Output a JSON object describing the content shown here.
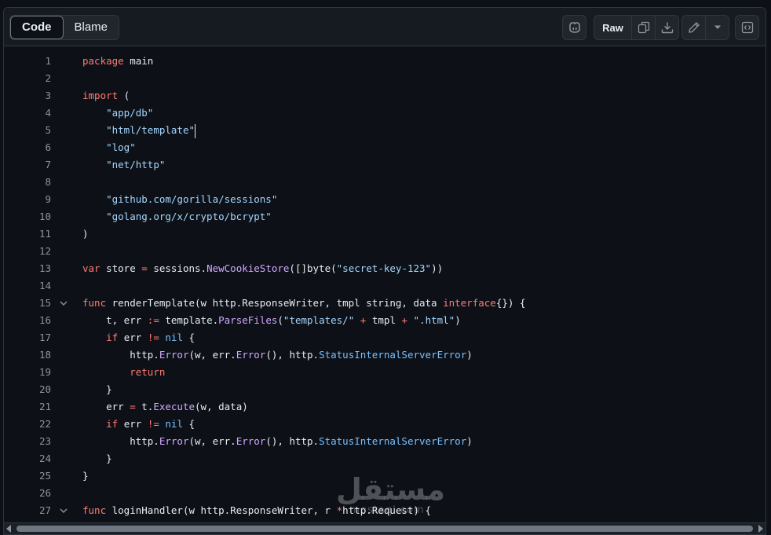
{
  "tabs": {
    "code_label": "Code",
    "blame_label": "Blame"
  },
  "toolbar": {
    "raw_label": "Raw",
    "icons": [
      "copilot-icon",
      "copy-icon",
      "download-icon",
      "pencil-icon",
      "triangle-down-icon",
      "code-square-icon"
    ]
  },
  "code_lines": [
    {
      "n": "1",
      "fold": "",
      "html": "<span class=\"kw\">package</span> main"
    },
    {
      "n": "2",
      "fold": "",
      "html": ""
    },
    {
      "n": "3",
      "fold": "",
      "html": "<span class=\"kw\">import</span> ("
    },
    {
      "n": "4",
      "fold": "",
      "html": "    <span class=\"str\">\"app/db\"</span>"
    },
    {
      "n": "5",
      "fold": "",
      "html": "    <span class=\"str\">\"html/template\"</span><span class=\"cursor\"></span>"
    },
    {
      "n": "6",
      "fold": "",
      "html": "    <span class=\"str\">\"log\"</span>"
    },
    {
      "n": "7",
      "fold": "",
      "html": "    <span class=\"str\">\"net/http\"</span>"
    },
    {
      "n": "8",
      "fold": "",
      "html": ""
    },
    {
      "n": "9",
      "fold": "",
      "html": "    <span class=\"str\">\"github.com/gorilla/sessions\"</span>"
    },
    {
      "n": "10",
      "fold": "",
      "html": "    <span class=\"str\">\"golang.org/x/crypto/bcrypt\"</span>"
    },
    {
      "n": "11",
      "fold": "",
      "html": ")"
    },
    {
      "n": "12",
      "fold": "",
      "html": ""
    },
    {
      "n": "13",
      "fold": "",
      "html": "<span class=\"kw\">var</span> store <span class=\"op\">=</span> sessions.<span class=\"fn\">NewCookieStore</span>([]byte(<span class=\"str\">\"secret-key-123\"</span>))"
    },
    {
      "n": "14",
      "fold": "",
      "html": ""
    },
    {
      "n": "15",
      "fold": "⌄",
      "html": "<span class=\"kw\">func</span> renderTemplate(w http.ResponseWriter, tmpl string, data <span class=\"kw\">interface</span>{}) {"
    },
    {
      "n": "16",
      "fold": "",
      "html": "    t, err <span class=\"op\">:=</span> template.<span class=\"fn\">ParseFiles</span>(<span class=\"str\">\"templates/\"</span> <span class=\"op\">+</span> tmpl <span class=\"op\">+</span> <span class=\"str\">\".html\"</span>)"
    },
    {
      "n": "17",
      "fold": "",
      "html": "    <span class=\"kw\">if</span> err <span class=\"op\">!=</span> <span class=\"mem\">nil</span> {"
    },
    {
      "n": "18",
      "fold": "",
      "html": "        http.<span class=\"fn\">Error</span>(w, err.<span class=\"fn\">Error</span>(), http.<span class=\"mem\">StatusInternalServerError</span>)"
    },
    {
      "n": "19",
      "fold": "",
      "html": "        <span class=\"kw\">return</span>"
    },
    {
      "n": "20",
      "fold": "",
      "html": "    }"
    },
    {
      "n": "21",
      "fold": "",
      "html": "    err <span class=\"op\">=</span> t.<span class=\"fn\">Execute</span>(w, data)"
    },
    {
      "n": "22",
      "fold": "",
      "html": "    <span class=\"kw\">if</span> err <span class=\"op\">!=</span> <span class=\"mem\">nil</span> {"
    },
    {
      "n": "23",
      "fold": "",
      "html": "        http.<span class=\"fn\">Error</span>(w, err.<span class=\"fn\">Error</span>(), http.<span class=\"mem\">StatusInternalServerError</span>)"
    },
    {
      "n": "24",
      "fold": "",
      "html": "    }"
    },
    {
      "n": "25",
      "fold": "",
      "html": "}"
    },
    {
      "n": "26",
      "fold": "",
      "html": ""
    },
    {
      "n": "27",
      "fold": "⌄",
      "html": "<span class=\"kw\">func</span> loginHandler(w http.ResponseWriter, r <span class=\"op\">*</span>http.Request) {"
    }
  ],
  "watermark": {
    "arabic": "مستقل",
    "latin": "mostaql.com"
  },
  "colors": {
    "background": "#0d1117",
    "keyword": "#ff7b72",
    "string": "#a5d6ff",
    "function": "#d2a8ff",
    "constant": "#79c0ff"
  }
}
